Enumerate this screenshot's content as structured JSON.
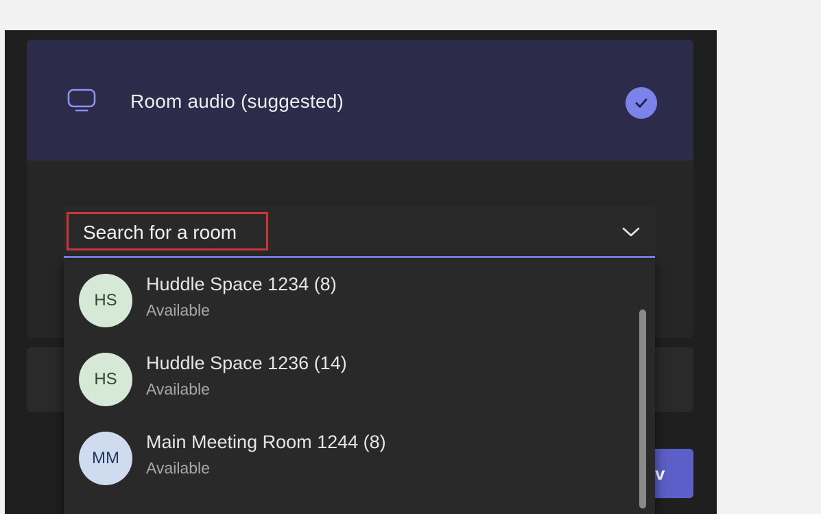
{
  "audio_option": {
    "label": "Room audio (suggested)",
    "icon": "room-display-icon",
    "selected": true,
    "check_icon": "checkmark-icon"
  },
  "search": {
    "placeholder": "Search for a room",
    "dropdown_icon": "chevron-down-icon"
  },
  "background_button": {
    "label": "v"
  },
  "rooms": [
    {
      "initials": "HS",
      "name": "Huddle Space 1234 (8)",
      "status": "Available"
    },
    {
      "initials": "HS",
      "name": "Huddle Space 1236 (14)",
      "status": "Available"
    },
    {
      "initials": "MM",
      "name": "Main Meeting Room 1244 (8)",
      "status": "Available"
    }
  ],
  "colors": {
    "accent": "#7b83eb",
    "button": "#5b5fc7",
    "highlight": "#d13438",
    "panel_selected": "#2c2b4a",
    "window": "#1f1f1f"
  }
}
